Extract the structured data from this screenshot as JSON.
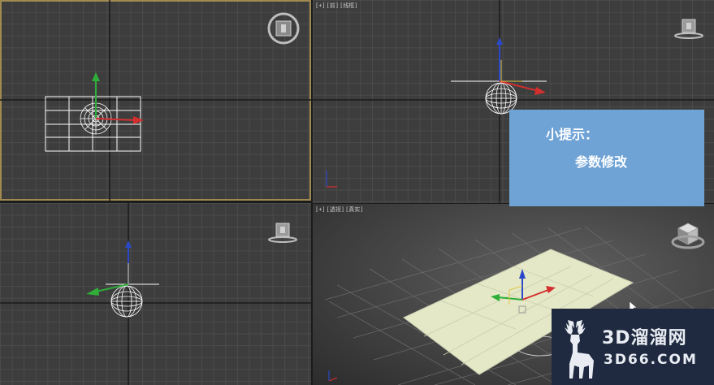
{
  "viewports": {
    "top": {},
    "front": {
      "label": [
        "[+]",
        "[前]",
        "[线框]"
      ]
    },
    "left": {},
    "perspective": {
      "label": [
        "[+]",
        "[透视]",
        "[真实]"
      ]
    }
  },
  "tip": {
    "title": "小提示：",
    "body": "参数修改"
  },
  "watermark": {
    "brand": "3D溜溜网",
    "domain": "3D66.COM"
  },
  "colors": {
    "grid_bg": "#3d3d3d",
    "active_border": "#a08a52",
    "tip_bg": "#6fa3d6",
    "plane_fill": "#e4e8c6",
    "axis_x": "#d32f2f",
    "axis_y": "#2fae3a",
    "axis_z": "#2b48c8"
  },
  "icons": [
    "viewcube-icon",
    "deer-logo-icon",
    "cursor-icon"
  ]
}
